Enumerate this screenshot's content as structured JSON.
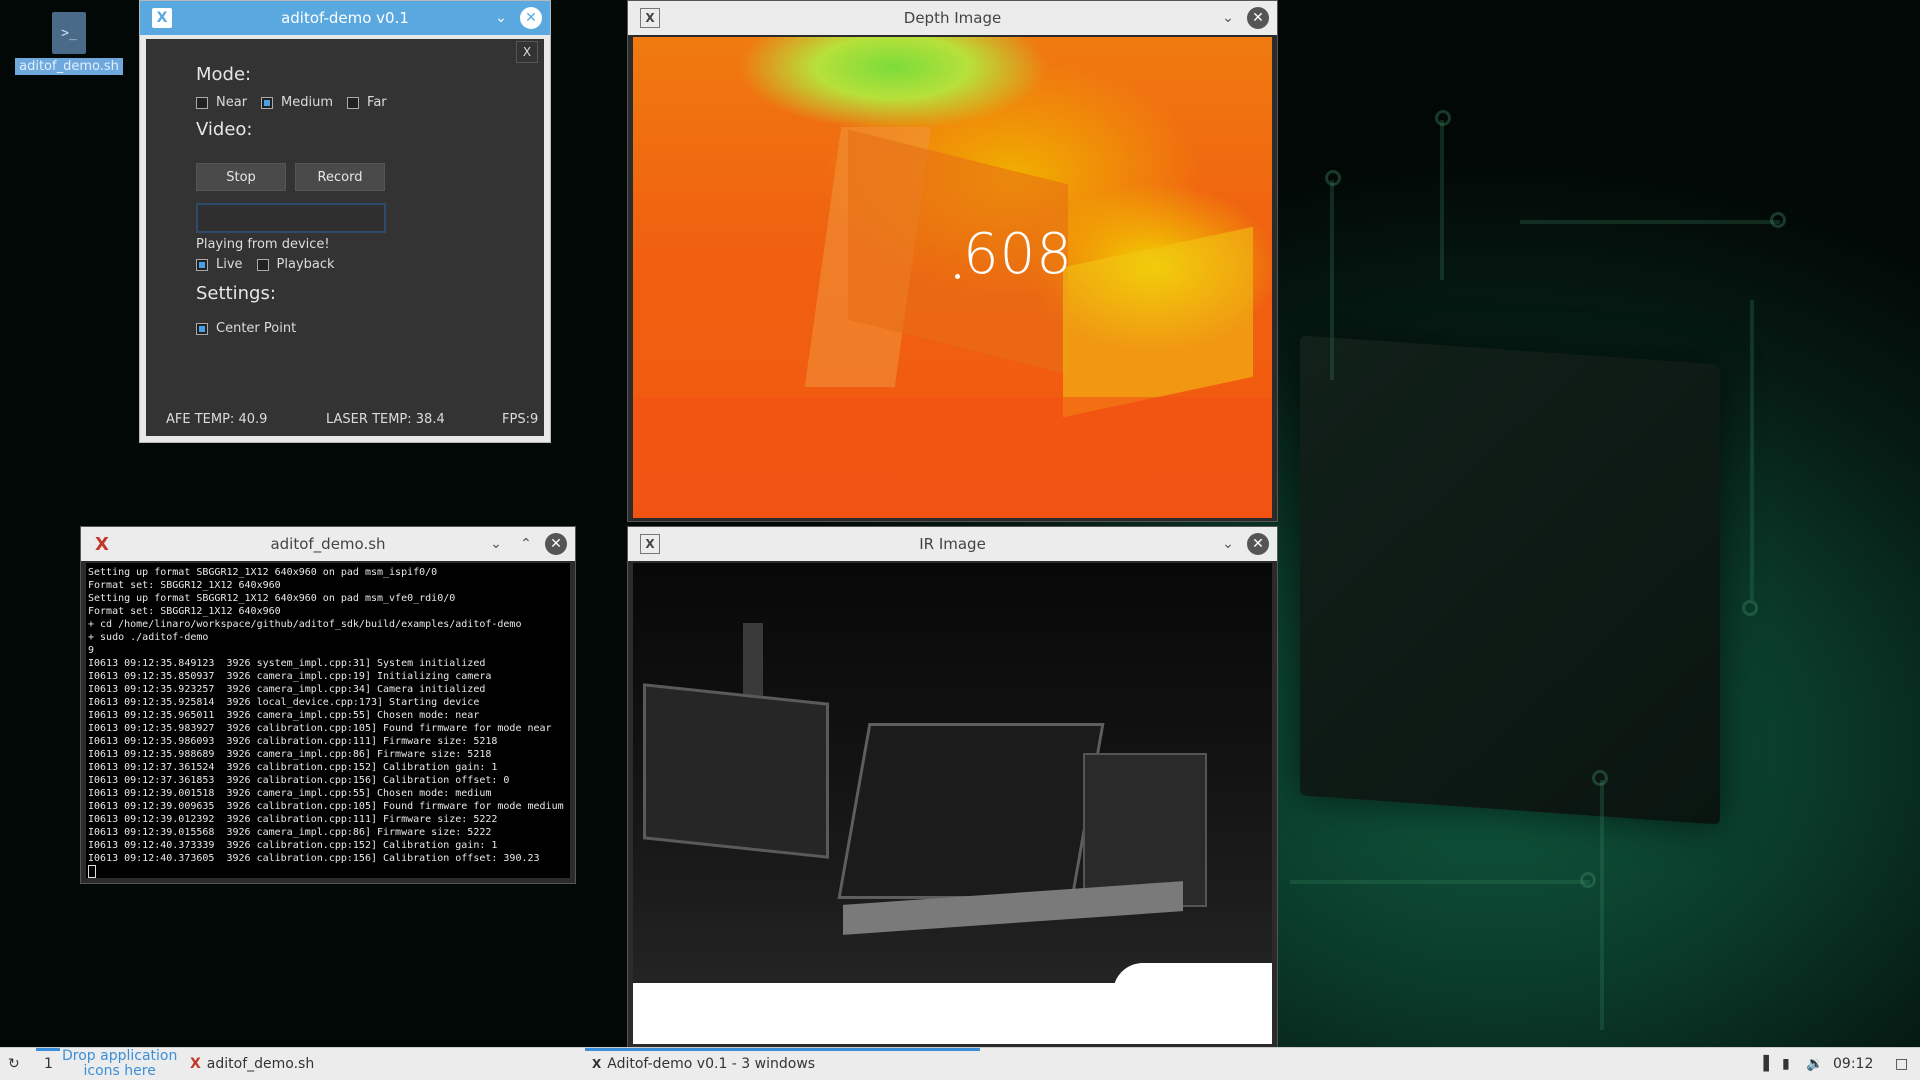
{
  "desktop": {
    "icon_label": "aditof_demo.sh",
    "icon_glyph": ">_"
  },
  "control_window": {
    "title": "aditof-demo v0.1",
    "panel_close": "X",
    "mode_heading": "Mode:",
    "modes": [
      {
        "label": "Near",
        "checked": false
      },
      {
        "label": "Medium",
        "checked": true
      },
      {
        "label": "Far",
        "checked": false
      }
    ],
    "video_heading": "Video:",
    "stop_label": "Stop",
    "record_label": "Record",
    "filename_value": "",
    "status_text": "Playing from device!",
    "sources": [
      {
        "label": "Live",
        "checked": true
      },
      {
        "label": "Playback",
        "checked": false
      }
    ],
    "settings_heading": "Settings:",
    "center_point": {
      "label": "Center Point",
      "checked": true
    },
    "afe_temp": "AFE TEMP: 40.9",
    "laser_temp": "LASER TEMP: 38.4",
    "fps": "FPS:9"
  },
  "depth_window": {
    "title": "Depth Image",
    "center_value": "608"
  },
  "ir_window": {
    "title": "IR Image"
  },
  "terminal_window": {
    "title": "aditof_demo.sh",
    "lines": [
      "Setting up format SBGGR12_1X12 640x960 on pad msm_ispif0/0",
      "Format set: SBGGR12_1X12 640x960",
      "Setting up format SBGGR12_1X12 640x960 on pad msm_vfe0_rdi0/0",
      "Format set: SBGGR12_1X12 640x960",
      "+ cd /home/linaro/workspace/github/aditof_sdk/build/examples/aditof-demo",
      "+ sudo ./aditof-demo",
      "9",
      "I0613 09:12:35.849123  3926 system_impl.cpp:31] System initialized",
      "I0613 09:12:35.850937  3926 camera_impl.cpp:19] Initializing camera",
      "I0613 09:12:35.923257  3926 camera_impl.cpp:34] Camera initialized",
      "I0613 09:12:35.925814  3926 local_device.cpp:173] Starting device",
      "I0613 09:12:35.965011  3926 camera_impl.cpp:55] Chosen mode: near",
      "I0613 09:12:35.983927  3926 calibration.cpp:105] Found firmware for mode near",
      "I0613 09:12:35.986093  3926 calibration.cpp:111] Firmware size: 5218",
      "I0613 09:12:35.988689  3926 camera_impl.cpp:86] Firmware size: 5218",
      "I0613 09:12:37.361524  3926 calibration.cpp:152] Calibration gain: 1",
      "I0613 09:12:37.361853  3926 calibration.cpp:156] Calibration offset: 0",
      "I0613 09:12:39.001518  3926 camera_impl.cpp:55] Chosen mode: medium",
      "I0613 09:12:39.009635  3926 calibration.cpp:105] Found firmware for mode medium",
      "I0613 09:12:39.012392  3926 calibration.cpp:111] Firmware size: 5222",
      "I0613 09:12:39.015568  3926 camera_impl.cpp:86] Firmware size: 5222",
      "I0613 09:12:40.373339  3926 calibration.cpp:152] Calibration gain: 1",
      "I0613 09:12:40.373605  3926 calibration.cpp:156] Calibration offset: 390.23"
    ]
  },
  "taskbar": {
    "workspace": "1",
    "drop_hint_line1": "Drop application",
    "drop_hint_line2": "icons here",
    "task_terminal": "aditof_demo.sh",
    "task_demo": "Aditof-demo v0.1 - 3 windows",
    "clock": "09:12"
  }
}
